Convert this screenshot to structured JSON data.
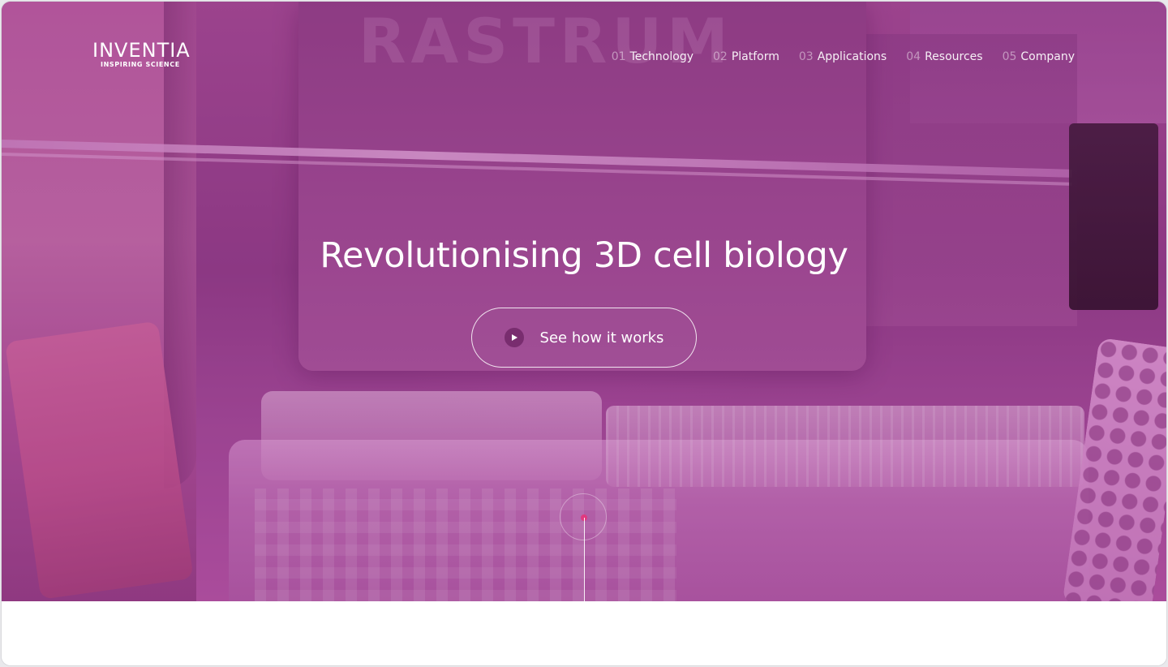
{
  "brand": {
    "name": "INVENTIA",
    "tagline": "INSPIRING SCIENCE"
  },
  "background": {
    "device_text": "RASTRUM"
  },
  "nav": {
    "items": [
      {
        "num": "01",
        "label": "Technology"
      },
      {
        "num": "02",
        "label": "Platform"
      },
      {
        "num": "03",
        "label": "Applications"
      },
      {
        "num": "04",
        "label": "Resources"
      },
      {
        "num": "05",
        "label": "Company"
      }
    ]
  },
  "hero": {
    "headline": "Revolutionising 3D cell biology",
    "cta_label": "See how it works",
    "cta_icon": "play-icon",
    "scroll_indicator_icon": "scroll-down-indicator"
  },
  "colors": {
    "hero_tint": "#8c3f84",
    "accent_dot": "#e0397f",
    "text": "#ffffff"
  }
}
